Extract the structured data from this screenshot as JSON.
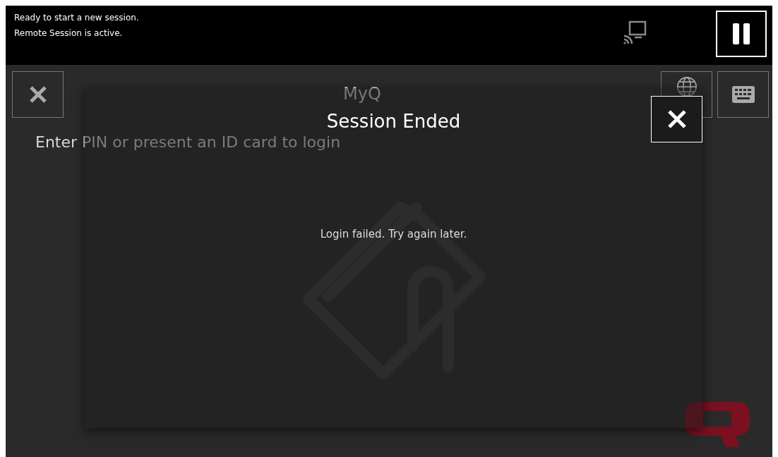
{
  "status_bar": {
    "lines": [
      "Ready to start a new session.",
      "Remote Session is active."
    ]
  },
  "screen": {
    "title": "MyQ",
    "prompt": "Enter PIN or present an ID card to login"
  },
  "dialog": {
    "title": "Session Ended",
    "message": "Login failed. Try again later."
  }
}
